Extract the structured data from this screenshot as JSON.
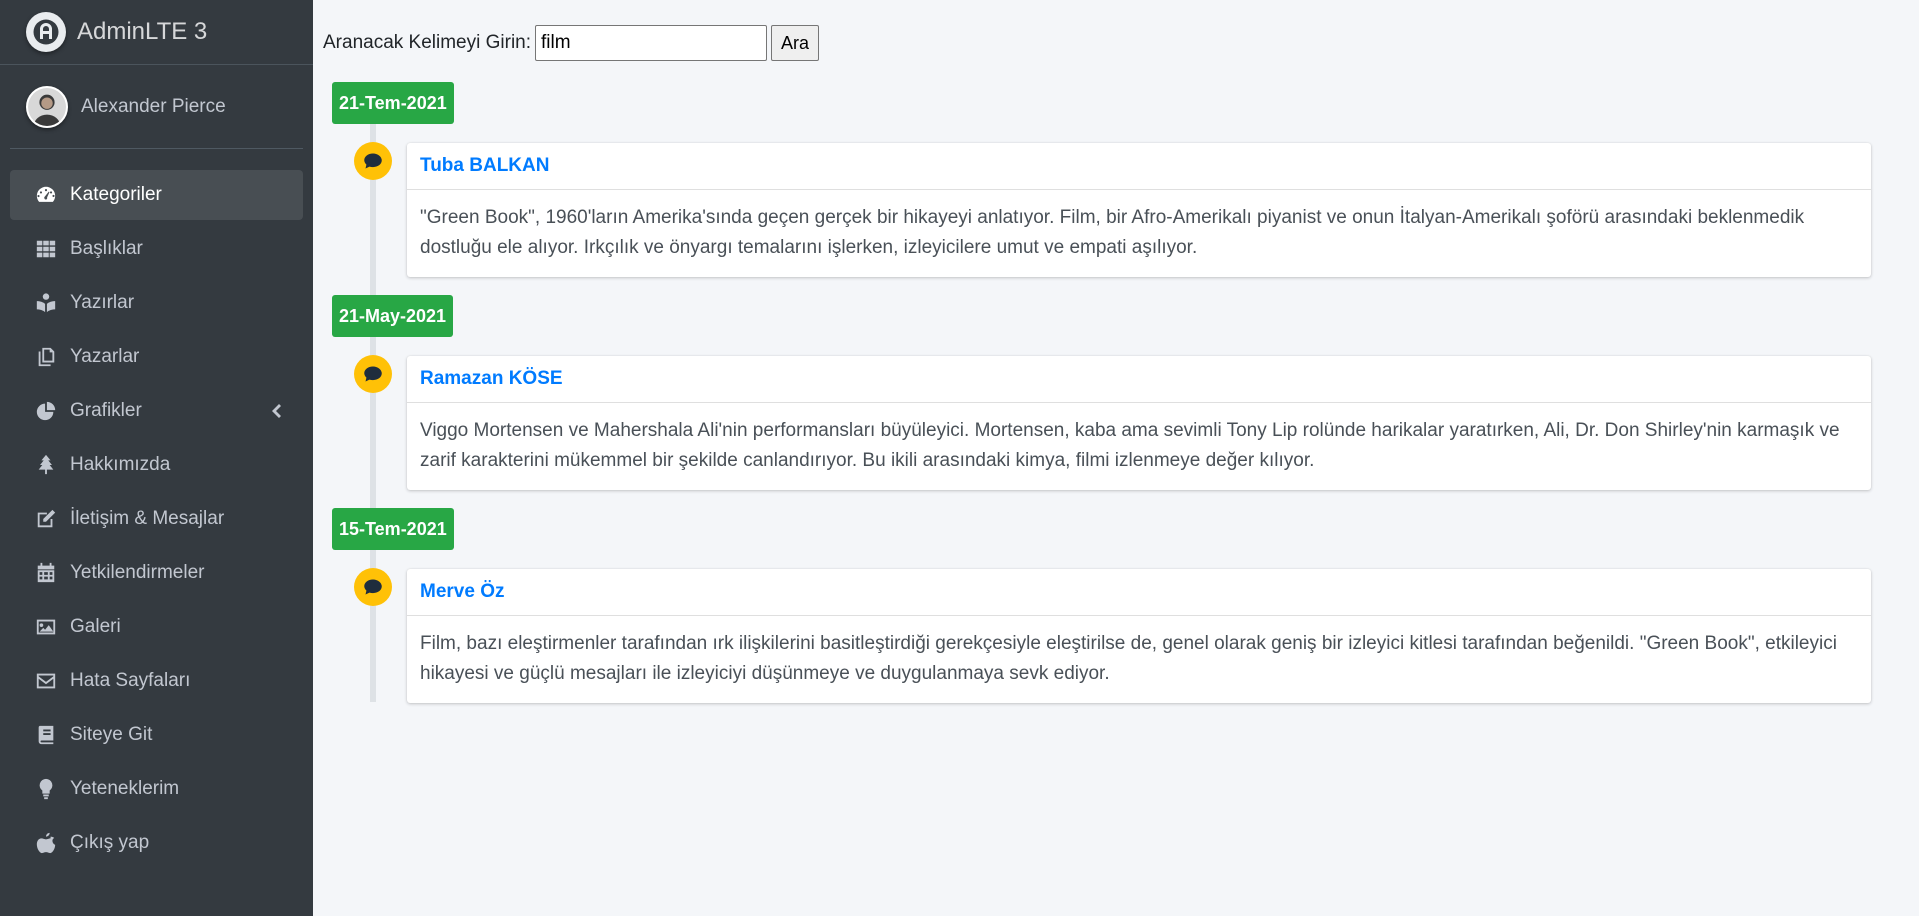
{
  "brand": {
    "name": "AdminLTE 3"
  },
  "user": {
    "name": "Alexander Pierce"
  },
  "nav": {
    "items": [
      {
        "label": "Kategoriler",
        "icon": "tachometer-icon",
        "active": true
      },
      {
        "label": "Başlıklar",
        "icon": "th-grid-icon"
      },
      {
        "label": "Yazırlar",
        "icon": "book-reader-icon"
      },
      {
        "label": "Yazarlar",
        "icon": "copy-icon"
      },
      {
        "label": "Grafikler",
        "icon": "chart-pie-icon",
        "has_arrow": true
      },
      {
        "label": "Hakkımızda",
        "icon": "tree-icon"
      },
      {
        "label": "İletişim & Mesajlar",
        "icon": "edit-icon"
      },
      {
        "label": "Yetkilendirmeler",
        "icon": "calendar-icon"
      },
      {
        "label": "Galeri",
        "icon": "image-icon"
      },
      {
        "label": "Hata Sayfaları",
        "icon": "envelope-icon"
      },
      {
        "label": "Siteye Git",
        "icon": "book-icon"
      },
      {
        "label": "Yeteneklerim",
        "icon": "lightbulb-icon"
      },
      {
        "label": "Çıkış yap",
        "icon": "apple-icon"
      }
    ]
  },
  "search": {
    "label": "Aranacak Kelimeyi Girin:",
    "value": "film",
    "button": "Ara"
  },
  "timeline": [
    {
      "date": "21-Tem-2021",
      "author": "Tuba BALKAN",
      "text": "\"Green Book\", 1960'ların Amerika'sında geçen gerçek bir hikayeyi anlatıyor. Film, bir Afro-Amerikalı piyanist ve onun İtalyan-Amerikalı şoförü arasındaki beklenmedik dostluğu ele alıyor. Irkçılık ve önyargı temalarını işlerken, izleyicilere umut ve empati aşılıyor."
    },
    {
      "date": "21-May-2021",
      "author": "Ramazan KÖSE",
      "text": "Viggo Mortensen ve Mahershala Ali'nin performansları büyüleyici. Mortensen, kaba ama sevimli Tony Lip rolünde harikalar yaratırken, Ali, Dr. Don Shirley'nin karmaşık ve zarif karakterini mükemmel bir şekilde canlandırıyor. Bu ikili arasındaki kimya, filmi izlenmeye değer kılıyor."
    },
    {
      "date": "15-Tem-2021",
      "author": "Merve Öz",
      "text": "Film, bazı eleştirmenler tarafından ırk ilişkilerini basitleştirdiği gerekçesiyle eleştirilse de, genel olarak geniş bir izleyici kitlesi tarafından beğenildi. \"Green Book\", etkileyici hikayesi ve güçlü mesajları ile izleyiciyi düşünmeye ve duygulanmaya sevk ediyor."
    }
  ],
  "colors": {
    "sidebar_bg": "#343a40",
    "date_label": "#28a745",
    "timeline_icon": "#ffc107",
    "author_link": "#007bff"
  }
}
